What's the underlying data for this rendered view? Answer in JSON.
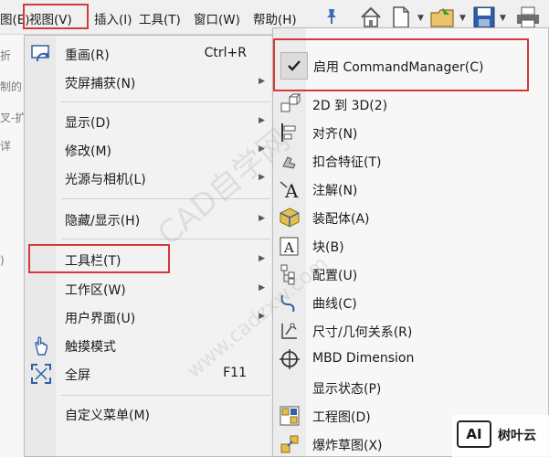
{
  "menubar": {
    "items": [
      {
        "label": "图(E)"
      },
      {
        "label": "视图(V)"
      },
      {
        "label": "插入(I)"
      },
      {
        "label": "工具(T)"
      },
      {
        "label": "窗口(W)"
      },
      {
        "label": "帮助(H)"
      }
    ]
  },
  "background": {
    "lines": [
      "折",
      "制的",
      "叉-扩",
      "详",
      ")"
    ]
  },
  "view_menu": {
    "items": [
      {
        "label": "重画(R)",
        "shortcut": "Ctrl+R"
      },
      {
        "label": "荧屏捕获(N)"
      },
      {
        "label": "显示(D)"
      },
      {
        "label": "修改(M)"
      },
      {
        "label": "光源与相机(L)"
      },
      {
        "label": "隐藏/显示(H)"
      },
      {
        "label": "工具栏(T)"
      },
      {
        "label": "工作区(W)"
      },
      {
        "label": "用户界面(U)"
      },
      {
        "label": "触摸模式"
      },
      {
        "label": "全屏",
        "shortcut": "F11"
      },
      {
        "label": "自定义菜单(M)"
      }
    ]
  },
  "toolbar_submenu": {
    "command_manager": "启用 CommandManager(C)",
    "items": [
      {
        "label": "2D 到 3D(2)"
      },
      {
        "label": "对齐(N)"
      },
      {
        "label": "扣合特征(T)"
      },
      {
        "label": "注解(N)"
      },
      {
        "label": "装配体(A)"
      },
      {
        "label": "块(B)"
      },
      {
        "label": "配置(U)"
      },
      {
        "label": "曲线(C)"
      },
      {
        "label": "尺寸/几何关系(R)"
      },
      {
        "label": "MBD Dimension"
      },
      {
        "label": "显示状态(P)"
      },
      {
        "label": "工程图(D)"
      },
      {
        "label": "爆炸草图(X)"
      }
    ]
  },
  "watermark": {
    "line1": "CAD自学网",
    "line2": "www.cadzxw.com"
  },
  "logo": {
    "mark": "AI",
    "name": "树叶云"
  },
  "colors": {
    "highlight": "#d33a3a",
    "menu_bg": "#f2f2f2"
  }
}
